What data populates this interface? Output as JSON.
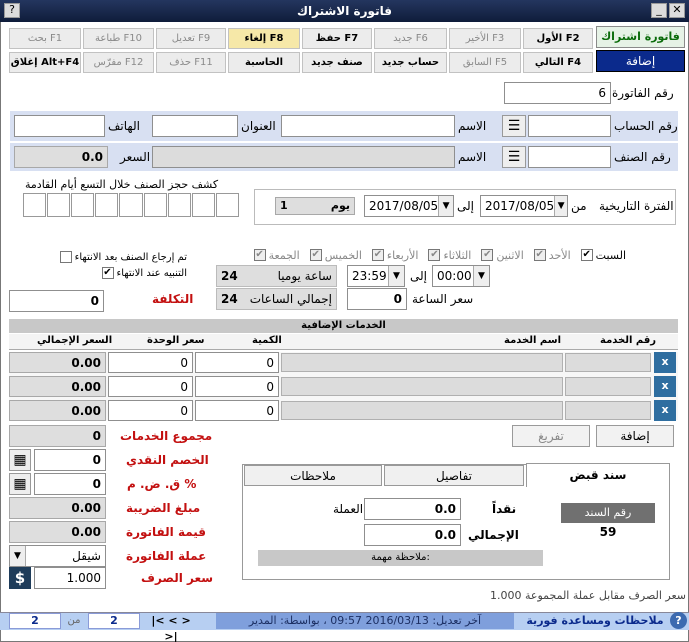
{
  "window": {
    "title": "فاتورة الاشتراك"
  },
  "toolbar": {
    "row1": [
      {
        "key": "first",
        "label": "الأول  F2",
        "active": true
      },
      {
        "key": "last",
        "label": "الأخير  F3",
        "active": false
      },
      {
        "key": "new",
        "label": "جديد  F6",
        "active": false
      },
      {
        "key": "save",
        "label": "حفظ  F7",
        "active": true
      },
      {
        "key": "cancel",
        "label": "إلغاء  F8",
        "active": true
      },
      {
        "key": "edit",
        "label": "تعديل  F9",
        "active": false
      },
      {
        "key": "print",
        "label": "طباعة  F10",
        "active": false
      },
      {
        "key": "search",
        "label": "بحث  F1",
        "active": false
      }
    ],
    "row2": [
      {
        "key": "next",
        "label": "التالي  F4",
        "active": true
      },
      {
        "key": "prev",
        "label": "السابق  F5",
        "active": false
      },
      {
        "key": "new_account",
        "label": "حساب جديد",
        "active": true
      },
      {
        "key": "new_item",
        "label": "صنف جديد",
        "active": true
      },
      {
        "key": "calculator",
        "label": "الحاسبة",
        "active": true
      },
      {
        "key": "delete",
        "label": "حذف  F11",
        "active": false
      },
      {
        "key": "clear",
        "label": "مفرّس  F12",
        "active": false
      },
      {
        "key": "close",
        "label": "إغلاق  Alt+F4",
        "active": true
      }
    ],
    "type_title": "فاتورة اشتراك",
    "mode_label": "إضافة"
  },
  "invoice": {
    "number_label": "رقم الفاتورة",
    "number": "6"
  },
  "account": {
    "account_no_label": "رقم الحساب",
    "account_no": "",
    "name_label": "الاسم",
    "name": "",
    "address_label": "العنوان",
    "address": "",
    "phone_label": "الهاتف",
    "phone": ""
  },
  "item": {
    "item_no_label": "رقم الصنف",
    "item_no": "",
    "name_label": "الاسم",
    "name": "",
    "price_label": "السعر",
    "price": "0.0"
  },
  "period": {
    "label": "الفترة التاريخية",
    "from_label": "من",
    "from": "2017/08/05",
    "to_label": "إلى",
    "to": "2017/08/05",
    "days": "1",
    "days_label": "يوم"
  },
  "booking": {
    "label": "كشف حجز الصنف خلال التسع أيام القادمة"
  },
  "weekdays": [
    {
      "label": "السبت",
      "checked": true
    },
    {
      "label": "الأحد",
      "checked": true
    },
    {
      "label": "الاثنين",
      "checked": true
    },
    {
      "label": "الثلاثاء",
      "checked": true
    },
    {
      "label": "الأربعاء",
      "checked": true
    },
    {
      "label": "الخميس",
      "checked": true
    },
    {
      "label": "الجمعة",
      "checked": true
    }
  ],
  "time": {
    "from": "00:00",
    "to_label": "إلى",
    "to": "23:59",
    "hours_daily": "24",
    "hours_daily_label": "ساعة يوميا",
    "hour_price_label": "سعر الساعة",
    "hour_price": "0",
    "total_hours": "24",
    "total_hours_label": "إجمالي الساعات"
  },
  "options": {
    "return_item_label": "تم إرجاع الصنف بعد الانتهاء",
    "return_item": false,
    "alert_label": "التنبيه عند الانتهاء",
    "alert": true
  },
  "cost": {
    "label": "التكلفة",
    "value": "0"
  },
  "services": {
    "title": "الخدمات الإضافية",
    "headers": [
      "رقم الخدمة",
      "اسم الخدمة",
      "الكمية",
      "سعر الوحدة",
      "السعر الإجمالي"
    ],
    "rows": [
      {
        "code": "",
        "name": "",
        "qty": "0",
        "unit_price": "0",
        "total": "0.00"
      },
      {
        "code": "",
        "name": "",
        "qty": "0",
        "unit_price": "0",
        "total": "0.00"
      },
      {
        "code": "",
        "name": "",
        "qty": "0",
        "unit_price": "0",
        "total": "0.00"
      }
    ],
    "add_label": "إضافة",
    "clear_label": "تفريغ"
  },
  "totals": {
    "services_total_label": "مجموع الخدمات",
    "services_total": "0",
    "cash_discount_label": "الخصم النقدي",
    "cash_discount": "0",
    "pct_label": "ق. ض. م  %",
    "pct": "0",
    "tax_amount_label": "مبلغ الضريبة",
    "tax_amount": "0.00",
    "invoice_value_label": "قيمة الفاتورة",
    "invoice_value": "0.00",
    "currency_label": "عملة الفاتورة",
    "currency": "شيقل",
    "exchange_rate_label": "سعر الصرف",
    "exchange_rate": "1.000"
  },
  "receipt": {
    "tabs": [
      "سند قبض",
      "تفاصيل",
      "ملاحظات"
    ],
    "cash_label": "نقداً",
    "cash": "0.0",
    "currency_label": "العملة",
    "total_label": "الإجمالي",
    "total": "0.0",
    "voucher_no_label": "رقم السند",
    "voucher_no": "59",
    "note_label": "ملاحظة مهمة:"
  },
  "footer": {
    "rate_note": "سعر الصرف مقابل عملة المجموعة 1.000",
    "status": "آخر تعديل: 2016/03/13 09:57 ، بواسطة: المدير",
    "help": "ملاحظات ومساعدة فورية",
    "nav": "|< < > >|",
    "page": "2",
    "of_label": "من",
    "total_pages": "2"
  },
  "colors": {
    "titlebar": "#1b2a4c",
    "label_band": "#d8e0f2",
    "red_label": "#c31010",
    "status_bar": "#7f9fdc",
    "mode": "#0b2a8c"
  }
}
